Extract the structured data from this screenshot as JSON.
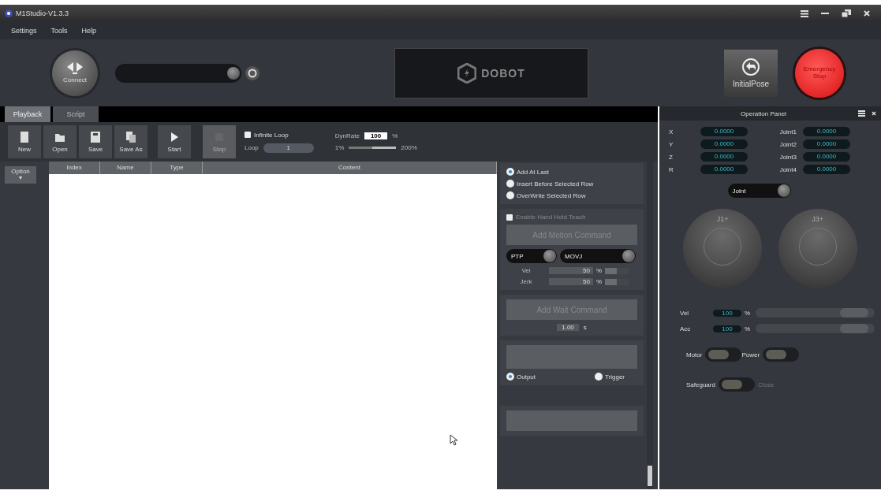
{
  "window": {
    "title": "M1Studio-V1.3.3"
  },
  "menu": [
    "Settings",
    "Tools",
    "Help"
  ],
  "connection": {
    "connect_label": "Connect"
  },
  "logo": {
    "text": "DOBOT"
  },
  "header_buttons": {
    "initial_pose": "InitialPose",
    "emergency_stop": "Emergency Stop"
  },
  "tabs": [
    {
      "label": "Playback",
      "selected": true
    },
    {
      "label": "Script",
      "selected": false
    }
  ],
  "toolbar": [
    {
      "label": "New",
      "kind": "new",
      "disabled": false
    },
    {
      "label": "Open",
      "kind": "open",
      "disabled": false
    },
    {
      "label": "Save",
      "kind": "save",
      "disabled": false
    },
    {
      "label": "Save As",
      "kind": "saveas",
      "disabled": false
    },
    {
      "label": "Start",
      "kind": "start",
      "disabled": false
    },
    {
      "label": "Stop",
      "kind": "stop",
      "disabled": true
    }
  ],
  "loop": {
    "infinite_label": "Infinite Loop",
    "infinite_checked": false,
    "loop_label": "Loop",
    "loop_value": "1"
  },
  "dyn_rate": {
    "label": "DynRate",
    "value": "100",
    "unit": "%",
    "min_label": "1%",
    "max_label": "200%",
    "level": 0.5
  },
  "option_button": {
    "label": "Option",
    "caret": "▾"
  },
  "table": {
    "columns": [
      "Index",
      "Name",
      "Type",
      "Content"
    ]
  },
  "insert_modes": [
    {
      "label": "Add At Last",
      "selected": true
    },
    {
      "label": "Insert Before Selected Row",
      "selected": false
    },
    {
      "label": "OverWrite Selected Row",
      "selected": false
    }
  ],
  "teach": {
    "label": "Enable Hand Hold Teach",
    "checked": false,
    "add_motion": "Add Motion Command",
    "mode": "PTP",
    "motion": "MOVJ",
    "params": [
      {
        "label": "Vel",
        "value": "50",
        "unit": "%",
        "level": 0.5
      },
      {
        "label": "Jerk",
        "value": "50",
        "unit": "%",
        "level": 0.5
      }
    ]
  },
  "wait": {
    "button": "Add Wait Command",
    "value": "1.00",
    "unit": "s"
  },
  "io": {
    "options": [
      {
        "label": "Output",
        "selected": true
      },
      {
        "label": "Trigger",
        "selected": false
      }
    ]
  },
  "operation_panel": {
    "title": "Operation Panel",
    "coords": [
      {
        "label": "X",
        "value": "0.0000"
      },
      {
        "label": "Y",
        "value": "0.0000"
      },
      {
        "label": "Z",
        "value": "0.0000"
      },
      {
        "label": "R",
        "value": "0.0000"
      }
    ],
    "joints": [
      {
        "label": "Joint1",
        "value": "0.0000"
      },
      {
        "label": "Joint2",
        "value": "0.0000"
      },
      {
        "label": "Joint3",
        "value": "0.0000"
      },
      {
        "label": "Joint4",
        "value": "0.0000"
      }
    ],
    "mode": "Joint",
    "jog_pads": [
      {
        "top": "J1+"
      },
      {
        "top": "J3+"
      }
    ],
    "speed": [
      {
        "label": "Vel",
        "value": "100",
        "unit": "%",
        "level": 0.95
      },
      {
        "label": "Acc",
        "value": "100",
        "unit": "%",
        "level": 0.95
      }
    ],
    "switches": [
      {
        "label": "Motor",
        "on": false
      },
      {
        "label": "Power",
        "on": false
      }
    ],
    "safeguard": {
      "label": "Safeguard",
      "on": false,
      "state_text": "Close"
    }
  }
}
